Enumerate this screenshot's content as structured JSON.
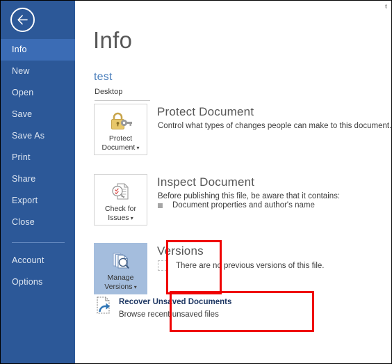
{
  "window": {
    "corner_glyph": "t"
  },
  "sidebar": {
    "back_button": {
      "name": "Back",
      "icon": "arrow-left-icon"
    },
    "items": [
      {
        "label": "Info",
        "active": true
      },
      {
        "label": "New",
        "active": false
      },
      {
        "label": "Open",
        "active": false
      },
      {
        "label": "Save",
        "active": false
      },
      {
        "label": "Save As",
        "active": false
      },
      {
        "label": "Print",
        "active": false
      },
      {
        "label": "Share",
        "active": false
      },
      {
        "label": "Export",
        "active": false
      },
      {
        "label": "Close",
        "active": false
      }
    ],
    "lower_items": [
      {
        "label": "Account"
      },
      {
        "label": "Options"
      }
    ]
  },
  "main": {
    "page_title": "Info",
    "document": {
      "name": "test",
      "location": "Desktop"
    },
    "sections": [
      {
        "key": "protect",
        "button_label_line1": "Protect",
        "button_label_line2": "Document",
        "button_icon": "lock-key-icon",
        "button_has_caret": true,
        "title": "Protect Document",
        "description": "Control what types of changes people can make to this document.",
        "bullets": []
      },
      {
        "key": "inspect",
        "button_label_line1": "Check for",
        "button_label_line2": "Issues",
        "button_icon": "document-inspect-icon",
        "button_has_caret": true,
        "title": "Inspect Document",
        "description": "Before publishing this file, be aware that it contains:",
        "bullets": [
          {
            "icon": "square-bullet",
            "text": "Document properties and author's name"
          }
        ]
      },
      {
        "key": "versions",
        "button_label_line1": "Manage",
        "button_label_line2": "Versions",
        "button_icon": "versions-stack-icon",
        "button_has_caret": true,
        "button_selected": true,
        "title": "Versions",
        "description": "",
        "bullets": [
          {
            "icon": "document-dashed-bullet",
            "text": "There are no previous versions of this file."
          }
        ]
      }
    ],
    "recover": {
      "icon": "recover-document-icon",
      "title": "Recover Unsaved Documents",
      "subtitle": "Browse recent unsaved files"
    }
  },
  "annotations": {
    "colors": {
      "highlight": "#ef0000"
    },
    "boxes": [
      {
        "name": "manage-versions-highlight",
        "target": "Manage Versions button"
      },
      {
        "name": "recover-unsaved-highlight",
        "target": "Recover Unsaved Documents"
      }
    ]
  },
  "colors": {
    "sidebar_bg": "#2c5898",
    "sidebar_active": "#3b6cb5",
    "accent_blue": "#4a7ebb",
    "selected_button": "#a4bddd",
    "annotation_red": "#ef0000"
  }
}
